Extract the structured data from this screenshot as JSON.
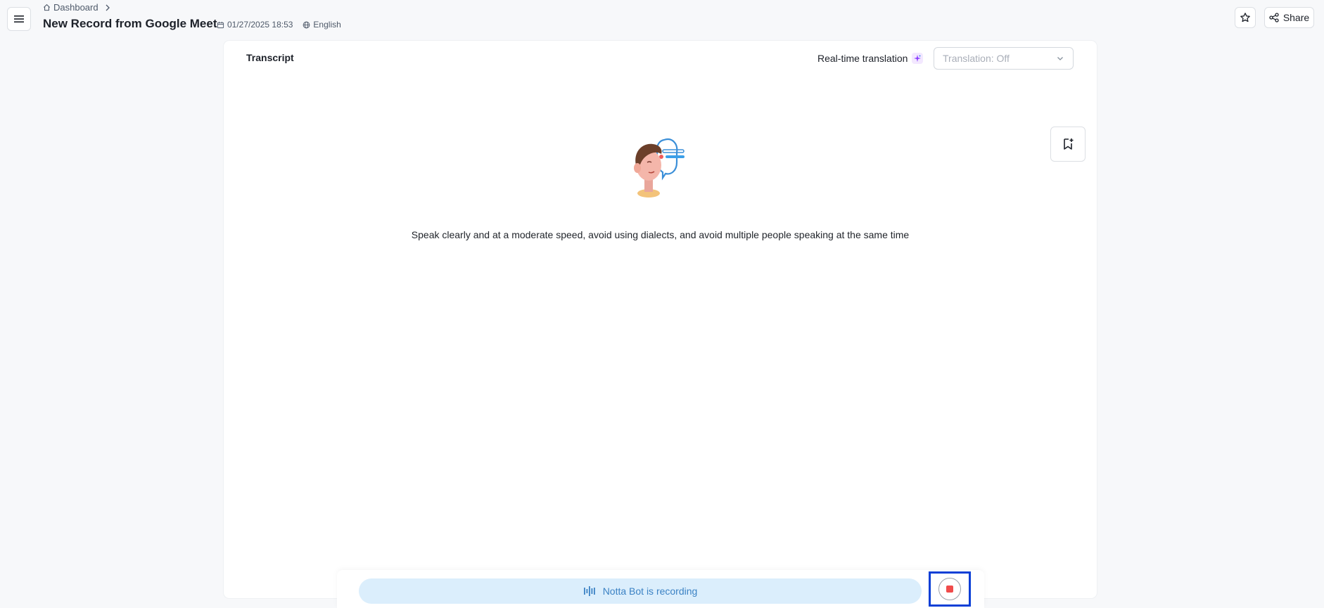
{
  "header": {
    "breadcrumb": {
      "home_label": "Dashboard"
    },
    "title": "New Record from Google Meet",
    "datetime": "01/27/2025 18:53",
    "language": "English",
    "share_label": "Share"
  },
  "transcript": {
    "title": "Transcript",
    "realtime_translation_label": "Real-time translation",
    "translation_select_value": "Translation: Off",
    "hint": "Speak clearly and at a moderate speed, avoid using dialects, and avoid multiple people speaking at the same time"
  },
  "recording": {
    "status": "Notta Bot is recording"
  },
  "icons": {
    "menu": "menu-icon",
    "home": "home-icon",
    "chevron": "chevron-right-icon",
    "calendar": "calendar-icon",
    "globe": "globe-icon",
    "star": "star-icon",
    "share": "share-icon",
    "spark": "sparkle-icon",
    "dropdown": "chevron-down-icon",
    "bookmark": "bookmark-add-icon",
    "waveform": "waveform-icon",
    "stop": "stop-icon"
  },
  "colors": {
    "accent": "#3b82c4",
    "recording_pill_bg": "#dbeefc",
    "stop_red": "#f04b4b",
    "highlight_border": "#0a3fd6"
  }
}
